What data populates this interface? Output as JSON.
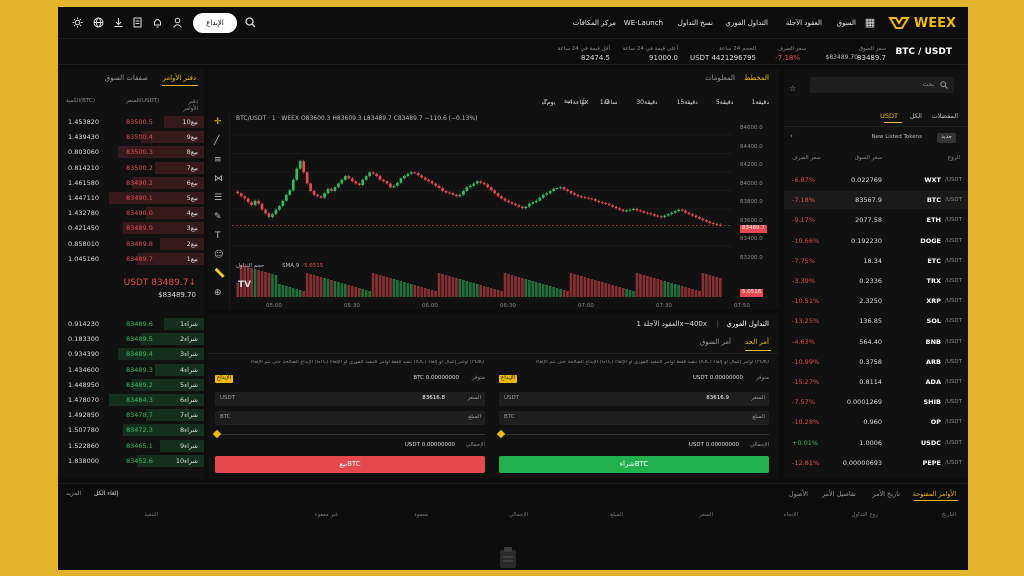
{
  "nav": {
    "brand": "WEEX",
    "items": [
      "السوق",
      "العقود الآجلة",
      "التداول الفوري",
      "نسخ التداول",
      "WE-Launch",
      "مركز المكافآت"
    ],
    "deposit_label": "الإيداع"
  },
  "ticker": {
    "pair": "BTC / USDT",
    "last_price": "83489.7",
    "index_price": "$83489.70",
    "change_label": "سعر الصرف",
    "change": "-7.18%",
    "volume_label": "الحجم 24 ساعة",
    "volume": "USDT 4421296795",
    "high_label": "أعلى قيمة في 24 ساعة",
    "high": "91000.0",
    "low_label": "أقل قيمة في 24 ساعة",
    "low": "82474.5"
  },
  "market_list": {
    "search_placeholder": "بحث",
    "tabs": [
      "المفضلات",
      "الكل",
      "USDT"
    ],
    "listed_tag": "جديد",
    "listed_label": "New Listed Tokens",
    "col_pair": "الزوج",
    "col_price": "سعر السوق",
    "col_change": "سعر الصرف",
    "rows": [
      {
        "base": "WXT",
        "quote": "/USDT",
        "price": "0.022769",
        "change": "-6.87%",
        "up": false
      },
      {
        "base": "BTC",
        "quote": "/USDT",
        "price": "83567.9",
        "change": "-7.18%",
        "up": false
      },
      {
        "base": "ETH",
        "quote": "/USDT",
        "price": "2077.58",
        "change": "-9.17%",
        "up": false
      },
      {
        "base": "DOGE",
        "quote": "/USDT",
        "price": "0.192230",
        "change": "-10.66%",
        "up": false
      },
      {
        "base": "ETC",
        "quote": "/USDT",
        "price": "18.34",
        "change": "-7.75%",
        "up": false
      },
      {
        "base": "TRX",
        "quote": "/USDT",
        "price": "0.2336",
        "change": "-3.39%",
        "up": false
      },
      {
        "base": "XRP",
        "quote": "/USDT",
        "price": "2.3250",
        "change": "-10.51%",
        "up": false
      },
      {
        "base": "SOL",
        "quote": "/USDT",
        "price": "136.85",
        "change": "-13.25%",
        "up": false
      },
      {
        "base": "BNB",
        "quote": "/USDT",
        "price": "564.40",
        "change": "-4.63%",
        "up": false
      },
      {
        "base": "ARB",
        "quote": "/USDT",
        "price": "0.3758",
        "change": "-10.99%",
        "up": false
      },
      {
        "base": "ADA",
        "quote": "/USDT",
        "price": "0.8114",
        "change": "-15.27%",
        "up": false
      },
      {
        "base": "SHIB",
        "quote": "/USDT",
        "price": "0.0001269",
        "change": "-7.57%",
        "up": false
      },
      {
        "base": "OP",
        "quote": "/USDT",
        "price": "0.960",
        "change": "-10.28%",
        "up": false
      },
      {
        "base": "USDC",
        "quote": "/USDT",
        "price": "1.0006",
        "change": "+0.01%",
        "up": true
      },
      {
        "base": "PEPE",
        "quote": "/USDT",
        "price": "0.00000693",
        "change": "-12.81%",
        "up": false
      }
    ]
  },
  "chart_header": {
    "tab_chart": "المخطط",
    "tab_info": "المعلومات",
    "intervals": [
      "1دقيقة",
      "5دقيقة",
      "15دقيقة",
      "30دقيقة",
      "1ساعة",
      "4ساعة",
      "1يوم"
    ],
    "ohlc": "BTC/USDT · 1 · WEEX  O83600.3 H83609.3 L83489.7 C83489.7 −110.6 (−0.13%)",
    "sma_label": "SMA 9",
    "sma_value": "5.6515",
    "vol_label": "حجم التداول",
    "price_tag": "83489.7",
    "vol_tag": "5.0516",
    "yticks": [
      "84600.0",
      "84400.0",
      "84200.0",
      "84000.0",
      "83800.0",
      "83600.0",
      "83400.0",
      "83200.0"
    ],
    "xticks": [
      "05:00",
      "05:30",
      "06:00",
      "06:30",
      "07:00",
      "07:30",
      "07:50"
    ]
  },
  "chart_data": {
    "type": "candlestick",
    "xticks": [
      "05:00",
      "05:30",
      "06:00",
      "06:30",
      "07:00",
      "07:30",
      "07:50"
    ],
    "ylim": [
      83200,
      84700
    ],
    "last_close": 83489.7,
    "close": [
      83920,
      83880,
      83850,
      83800,
      83760,
      83820,
      83780,
      83700,
      83650,
      83600,
      83640,
      83700,
      83750,
      83820,
      83900,
      83960,
      84100,
      84250,
      84350,
      84200,
      84050,
      83950,
      83900,
      83880,
      83860,
      83920,
      83980,
      83950,
      84000,
      84050,
      84100,
      84150,
      84120,
      84080,
      84050,
      84030,
      84100,
      84150,
      84200,
      84180,
      84150,
      84100,
      84080,
      84050,
      84000,
      84020,
      84060,
      84120,
      84150,
      84180,
      84200,
      84190,
      84160,
      84130,
      84100,
      84080,
      84050,
      84020,
      83990,
      83950,
      83930,
      83920,
      83900,
      83880,
      83900,
      83950,
      84000,
      84020,
      84050,
      84080,
      84060,
      84040,
      84000,
      83960,
      83920,
      83880,
      83850,
      83820,
      83800,
      83780,
      83760,
      83740,
      83720,
      83740,
      83780,
      83800,
      83820,
      83860,
      83900,
      83920,
      83950,
      83980,
      83990,
      84000,
      83970,
      83950,
      83920,
      83900,
      83880,
      83870,
      83860,
      83850,
      83840,
      83820,
      83800,
      83790,
      83780,
      83760,
      83740,
      83720,
      83700,
      83680,
      83690,
      83700,
      83710,
      83690,
      83680,
      83660,
      83650,
      83640,
      83620,
      83610,
      83600,
      83620,
      83640,
      83660,
      83680,
      83700,
      83690,
      83660,
      83640,
      83620,
      83600,
      83580,
      83560,
      83540,
      83520,
      83510,
      83500,
      83489.7
    ]
  },
  "trade": {
    "title": "التداول الفوري",
    "subtitle": "العقود الآجلة 1x~400x",
    "tab_limit": "أمر الحد",
    "tab_market": "أمر السوق",
    "options_note": "الإيداع الصالحة حتى يتم الإلغاء (GTC)  تنفيذ فقط  أوامر التنفيذ الفوري أو الإلغاء (IOC)  أوامر إكمال أو إلغاء (FOK)",
    "deposit_tag": "الإيداع",
    "available_label": "متوفر",
    "buy_available": "USDT 0.00000000",
    "sell_available": "BTC 0.00000000",
    "price_label": "السعر",
    "buy_price": "83616.9",
    "sell_price": "83616.8",
    "amount_label": "المبلغ",
    "buy_amount_unit": "BTC",
    "sell_amount_unit": "BTC",
    "quote_unit": "USDT",
    "total_label": "الإجمالي",
    "buy_total": "USDT 0.00000000",
    "sell_total": "USDT 0.00000000",
    "buy_button": "شراءBTC",
    "sell_button": "بيعBTC"
  },
  "orderbook": {
    "tab_book": "دفتر الأوامر",
    "tab_trades": "صفقات السوق",
    "col_side": "دفتر الأوامر",
    "col_price": "السعر(USDT)",
    "col_qty": "الكمية(BTC)",
    "asks": [
      {
        "label": "بيع10",
        "price": "83500.5",
        "qty": "1.453820"
      },
      {
        "label": "بيع9",
        "price": "83500.4",
        "qty": "1.439430"
      },
      {
        "label": "بيع8",
        "price": "83500.3",
        "qty": "0.803060"
      },
      {
        "label": "بيع7",
        "price": "83500.2",
        "qty": "0.814210"
      },
      {
        "label": "بيع6",
        "price": "83490.2",
        "qty": "1.461580"
      },
      {
        "label": "بيع5",
        "price": "83490.1",
        "qty": "1.447110"
      },
      {
        "label": "بيع4",
        "price": "83490.0",
        "qty": "1.432780"
      },
      {
        "label": "بيع3",
        "price": "83489.9",
        "qty": "0.421450"
      },
      {
        "label": "بيع2",
        "price": "83489.8",
        "qty": "0.858010"
      },
      {
        "label": "بيع1",
        "price": "83489.7",
        "qty": "1.045160"
      }
    ],
    "mid_price": "USDT 83489.7↓",
    "mid_index": "$83489.70",
    "bids": [
      {
        "label": "شراء1",
        "price": "83489.6",
        "qty": "0.914230"
      },
      {
        "label": "شراء2",
        "price": "83489.5",
        "qty": "0.183300"
      },
      {
        "label": "شراء3",
        "price": "83489.4",
        "qty": "0.934390"
      },
      {
        "label": "شراء4",
        "price": "83489.3",
        "qty": "1.434600"
      },
      {
        "label": "شراء5",
        "price": "83489.2",
        "qty": "1.448950"
      },
      {
        "label": "شراء6",
        "price": "83484.3",
        "qty": "1.478070"
      },
      {
        "label": "شراء7",
        "price": "83478.7",
        "qty": "1.492850"
      },
      {
        "label": "شراء8",
        "price": "83472.3",
        "qty": "1.507780"
      },
      {
        "label": "شراء9",
        "price": "83465.1",
        "qty": "1.522860"
      },
      {
        "label": "شراء10",
        "price": "83452.6",
        "qty": "1.838000"
      }
    ]
  },
  "orders": {
    "tabs": [
      "الأوامر المفتوحة",
      "تاريخ الأمر",
      "تفاصيل الأمر",
      "الأصول"
    ],
    "cancel_all": "إلغاء الكل",
    "more": "المزيد",
    "columns": [
      "التاريخ",
      "زوج التداول",
      "الاتجاه",
      "السعر",
      "المبلغ",
      "الإجمالي",
      "معفوء",
      "غير معفوء",
      "التنفيذ"
    ]
  },
  "colors": {
    "up": "#2ebd5f",
    "down": "#e5484d",
    "accent": "#f0b90b",
    "bg": "#0d0d0d",
    "panel": "#111111"
  }
}
